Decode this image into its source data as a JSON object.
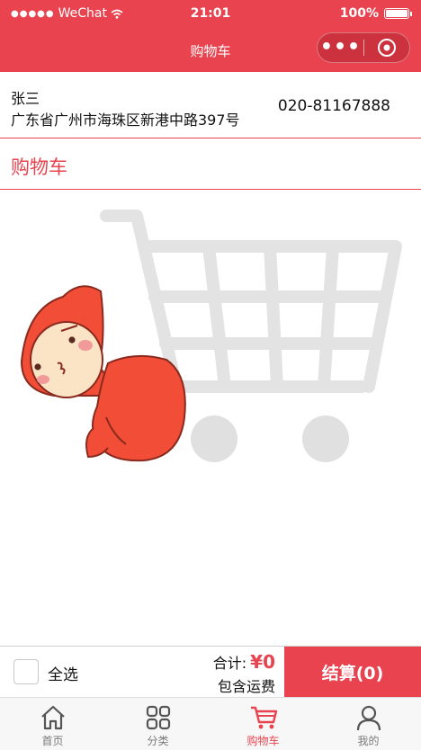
{
  "status_bar": {
    "carrier": "WeChat",
    "time": "21:01",
    "battery": "100%"
  },
  "nav": {
    "title": "购物车",
    "more_label": "•••"
  },
  "address": {
    "name": "张三",
    "line": "广东省广州市海珠区新港中路397号",
    "phone": "020-81167888"
  },
  "cart": {
    "section_title": "购物车",
    "empty_illustration": "empty-cart-with-cartoon-character"
  },
  "footer": {
    "select_all_label": "全选",
    "select_all_checked": false,
    "total_label": "合计:",
    "total_value": "¥0",
    "shipping_note": "包含运费",
    "checkout_label": "结算(0)"
  },
  "tabs": [
    {
      "label": "首页",
      "icon": "home-icon",
      "active": false
    },
    {
      "label": "分类",
      "icon": "category-icon",
      "active": false
    },
    {
      "label": "购物车",
      "icon": "cart-icon",
      "active": true
    },
    {
      "label": "我的",
      "icon": "profile-icon",
      "active": false
    }
  ],
  "colors": {
    "brand": "#e8434f",
    "tab_inactive": "#7a7a7a",
    "illustration_cart": "#e6e6e6"
  }
}
